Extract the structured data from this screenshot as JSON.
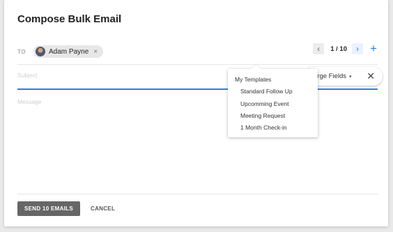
{
  "dialog": {
    "title": "Compose Bulk Email"
  },
  "recipients": {
    "label": "TO",
    "chips": [
      {
        "name": "Adam Payne",
        "remove": "×"
      }
    ]
  },
  "pager": {
    "prev": "‹",
    "count": "1 / 10",
    "next": "›",
    "add": "+"
  },
  "subject": {
    "placeholder": "Subject"
  },
  "merge_fields": {
    "label": "erge Fields",
    "caret": "▾",
    "close": "✕"
  },
  "templates_menu": {
    "heading": "My Templates",
    "items": [
      "Standard Follow Up",
      "Upcomming Event",
      "Meeting Request",
      "1 Month Check-in"
    ]
  },
  "message": {
    "placeholder": "Message"
  },
  "footer": {
    "send": "SEND 10 EMAILS",
    "cancel": "CANCEL"
  },
  "colors": {
    "accent": "#2d7de0",
    "send_button": "#666666"
  }
}
